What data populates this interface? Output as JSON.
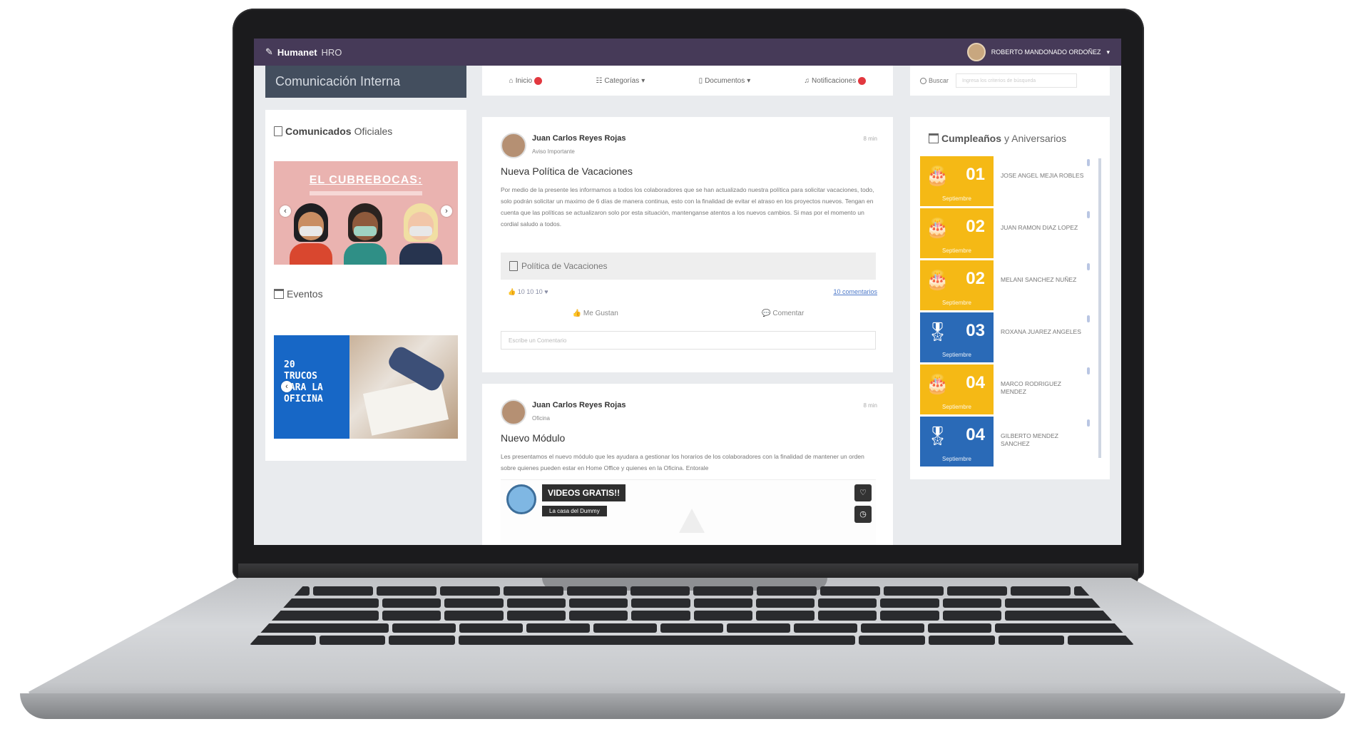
{
  "app": {
    "brand_name": "Humanet",
    "brand_suffix": "HRO",
    "user_name": "ROBERTO MANDONADO ORDOÑEZ"
  },
  "left": {
    "section_header": "Comunicación Interna",
    "official_title_bold": "Comunicados",
    "official_title_rest": "Oficiales",
    "banner1_title": "EL CUBREBOCAS:",
    "events_title": "Eventos",
    "banner2_text": [
      "20",
      "TRUCOS",
      "PARA LA",
      "OFICINA"
    ]
  },
  "nav": {
    "items": [
      {
        "label": "Inicio",
        "icon": "home-icon",
        "badge": true
      },
      {
        "label": "Categorías",
        "icon": "list-icon",
        "badge": false
      },
      {
        "label": "Documentos",
        "icon": "document-icon",
        "badge": false
      },
      {
        "label": "Notificaciones",
        "icon": "bell-icon",
        "badge": true
      }
    ]
  },
  "search": {
    "label": "Buscar",
    "placeholder": "Ingresa los criterios de búsqueda"
  },
  "posts": [
    {
      "author": "Juan Carlos Reyes Rojas",
      "tag": "Aviso Importante",
      "time": "8 min",
      "title": "Nueva Política de Vacaciones",
      "body": "Por medio de la presente les informamos a todos los colaboradores que se han actualizado nuestra política para solicitar vacaciones, todo, solo podrán solicitar un maximo de 6 días de manera continua, esto con la finalidad de evitar el atraso en los proyectos nuevos. Tengan en cuenta que las políticas se actualizaron solo por esta situación, mantenganse atentos a los nuevos cambios. Si mas por el momento un cordial saludo a todos.",
      "attachment": "Política de Vacaciones",
      "reactions": "10  10  10",
      "comments_link": "10 comentarios",
      "like_label": "Me Gustan",
      "comment_label": "Comentar",
      "comment_placeholder": "Escribe un Comentario"
    },
    {
      "author": "Juan Carlos Reyes Rojas",
      "tag": "Oficina",
      "time": "8 min",
      "title": "Nuevo Módulo",
      "body": "Les presentamos el nuevo módulo que les ayudara a gestionar los horarios de los colaboradores con la finalidad de mantener un orden sobre quienes pueden estar en Home Office y quienes en la Oficina. Entorale",
      "video_badge": "VIDEOS GRATIS!!",
      "video_channel": "La casa del Dummy"
    }
  ],
  "birthdays": {
    "title_bold": "Cumpleaños",
    "title_rest": "y Aniversarios",
    "items": [
      {
        "day": "01",
        "month": "Septiembre",
        "name": "JOSE ANGEL MEJIA ROBLES",
        "kind": "cake-icon",
        "color": "#f5b915"
      },
      {
        "day": "02",
        "month": "Septiembre",
        "name": "JUAN RAMON DIAZ LOPEZ",
        "kind": "cake-icon",
        "color": "#f5b915"
      },
      {
        "day": "02",
        "month": "Septiembre",
        "name": "MELANI SANCHEZ NUÑEZ",
        "kind": "cake-icon",
        "color": "#f5b915"
      },
      {
        "day": "03",
        "month": "Septiembre",
        "name": "ROXANA JUAREZ ANGELES",
        "kind": "medal-icon",
        "color": "#2a6ab7"
      },
      {
        "day": "04",
        "month": "Septiembre",
        "name": "MARCO RODRIGUEZ MENDEZ",
        "kind": "cake-icon",
        "color": "#f5b915"
      },
      {
        "day": "04",
        "month": "Septiembre",
        "name": "GILBERTO MENDEZ SANCHEZ",
        "kind": "medal-icon",
        "color": "#2a6ab7"
      }
    ]
  }
}
